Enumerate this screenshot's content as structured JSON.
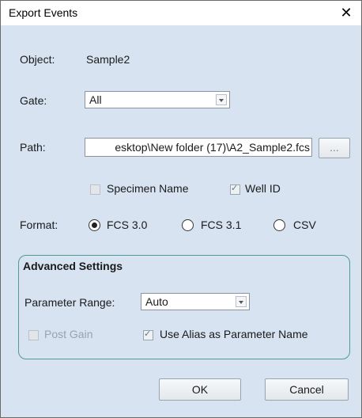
{
  "window": {
    "title": "Export Events",
    "close_glyph": "✕"
  },
  "object": {
    "label": "Object:",
    "value": "Sample2"
  },
  "gate": {
    "label": "Gate:",
    "value": "All"
  },
  "path": {
    "label": "Path:",
    "value": "esktop\\New folder (17)\\A2_Sample2.fcs",
    "browse_label": "..."
  },
  "options": {
    "specimen_name": {
      "label": "Specimen Name",
      "checked": false,
      "enabled": false
    },
    "well_id": {
      "label": "Well ID",
      "checked": true,
      "enabled": false
    }
  },
  "format": {
    "label": "Format:",
    "choices": [
      {
        "label": "FCS 3.0",
        "selected": true
      },
      {
        "label": "FCS 3.1",
        "selected": false
      },
      {
        "label": "CSV",
        "selected": false
      }
    ]
  },
  "advanced": {
    "title": "Advanced Settings",
    "parameter_range": {
      "label": "Parameter Range:",
      "value": "Auto"
    },
    "post_gain": {
      "label": "Post Gain",
      "checked": false,
      "enabled": false
    },
    "use_alias": {
      "label": "Use Alias as Parameter Name",
      "checked": true,
      "enabled": false
    }
  },
  "buttons": {
    "ok": "OK",
    "cancel": "Cancel"
  },
  "colors": {
    "dialog_bg": "#d7e3f1",
    "group_border": "#4b9d96"
  }
}
